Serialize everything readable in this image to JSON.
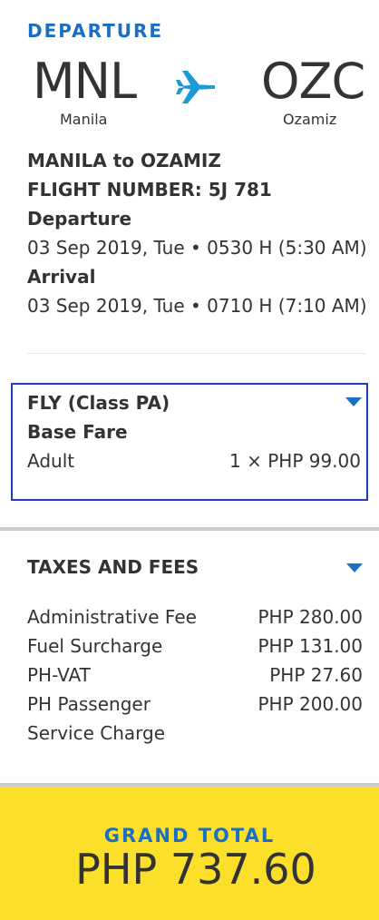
{
  "departure": {
    "title": "DEPARTURE",
    "origin_code": "MNL",
    "origin_city": "Manila",
    "destination_code": "OZC",
    "destination_city": "Ozamiz",
    "route": "MANILA to OZAMIZ",
    "flight_number": "FLIGHT NUMBER: 5J 781",
    "departure_label": "Departure",
    "departure_value": "03 Sep 2019, Tue • 0530 H (5:30 AM)",
    "arrival_label": "Arrival",
    "arrival_value": "03 Sep 2019, Tue • 0710 H (7:10 AM)"
  },
  "fare": {
    "class_label": "FLY (Class PA)",
    "base_fare_label": "Base Fare",
    "passenger_type": "Adult",
    "amount": "1 × PHP 99.00"
  },
  "taxes": {
    "title": "TAXES AND FEES",
    "items": [
      {
        "name": "Administrative Fee",
        "amount": "PHP 280.00"
      },
      {
        "name": "Fuel Surcharge",
        "amount": "PHP 131.00"
      },
      {
        "name": "PH-VAT",
        "amount": "PHP 27.60"
      },
      {
        "name": "PH Passenger",
        "amount": "PHP 200.00"
      }
    ],
    "continuation": "Service Charge"
  },
  "grand_total": {
    "label": "GRAND TOTAL",
    "amount": "PHP 737.60"
  },
  "colors": {
    "accent_blue": "#1a6fc4",
    "fare_border": "#1f3fbf",
    "total_background": "#fbdf2a"
  },
  "icons": {
    "plane": "airplane-icon",
    "expand": "caret-down-icon"
  }
}
